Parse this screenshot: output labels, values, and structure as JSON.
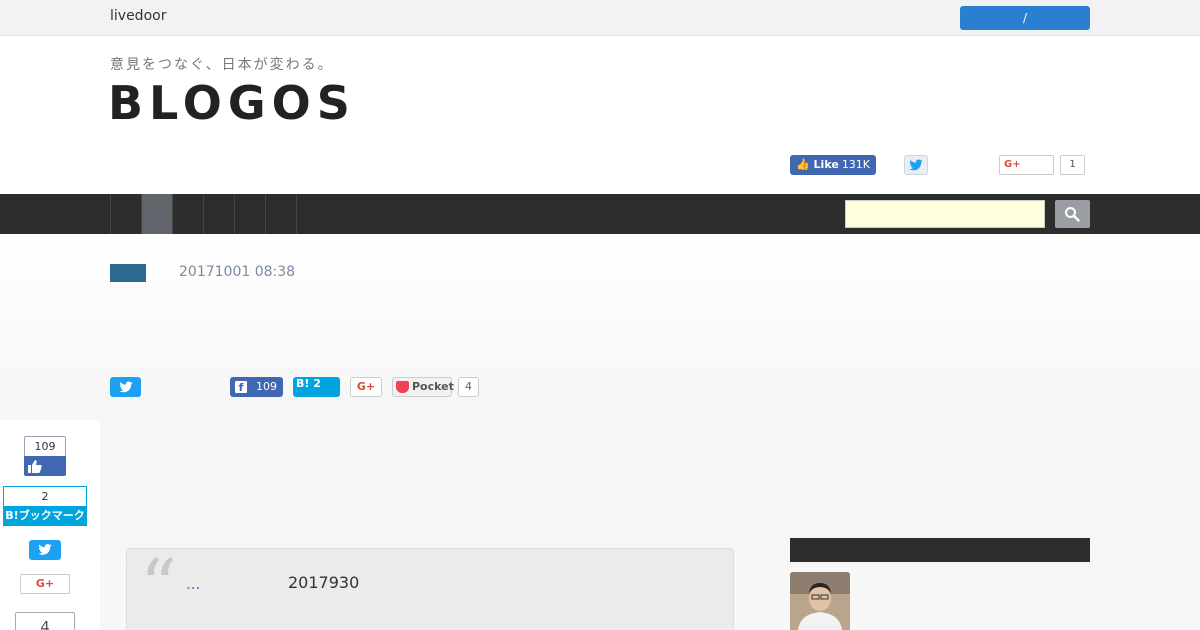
{
  "topbar": {
    "brand": "livedoor",
    "login_label": "/"
  },
  "header": {
    "tagline": "意見をつなぐ、日本が変わる。",
    "logo": "BLOGOS",
    "social": {
      "fb_like_label": "Like",
      "fb_like_count": "131K",
      "gplus_label": "G+",
      "gplus_count": "1"
    }
  },
  "nav": {
    "items": [
      "",
      "",
      "",
      "",
      "",
      ""
    ],
    "active_index": 1,
    "search": {
      "placeholder": "",
      "value": ""
    }
  },
  "article": {
    "date": "20171001 08:38",
    "share": {
      "facebook_icon": "f",
      "facebook_count": "109",
      "hatena_label": "B!",
      "hatena_count": "2",
      "gplus_label": "G+",
      "pocket_label": "Pocket",
      "pocket_count": "4"
    },
    "quote": {
      "mark": "“",
      "link_text": "...",
      "date": "2017930"
    }
  },
  "float_share": {
    "fb_count": "109",
    "hatena_count": "2",
    "hatena_label": "B!ブックマーク",
    "gplus_label": "G+",
    "pocket_count": "4"
  },
  "colors": {
    "nav_bg": "#2d2d2d",
    "accent_blue": "#2a7fd0",
    "facebook": "#4267b2",
    "twitter": "#1da1f2",
    "hatena": "#00a4de",
    "pocket": "#ee4056",
    "category_tag": "#2b6a8e"
  }
}
